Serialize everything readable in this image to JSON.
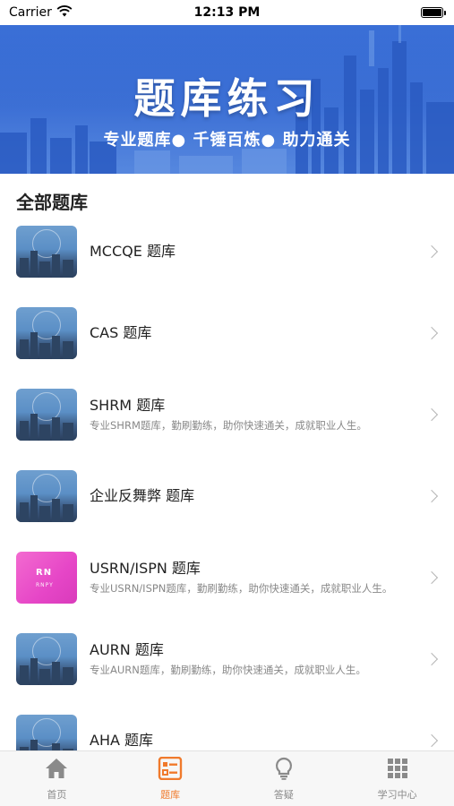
{
  "status_bar": {
    "carrier": "Carrier",
    "time": "12:13 PM"
  },
  "banner": {
    "title": "题库练习",
    "subtitle": "专业题库● 千锤百炼● 助力通关"
  },
  "section": {
    "title": "全部题库"
  },
  "banks": [
    {
      "title": "MCCQE 题库",
      "desc": "",
      "thumb": "city"
    },
    {
      "title": "CAS 题库",
      "desc": "",
      "thumb": "city"
    },
    {
      "title": "SHRM 题库",
      "desc": "专业SHRM题库，勤刷勤练，助你快速通关，成就职业人生。",
      "thumb": "city"
    },
    {
      "title": "企业反舞弊 题库",
      "desc": "",
      "thumb": "city"
    },
    {
      "title": "USRN/ISPN 题库",
      "desc": "专业USRN/ISPN题库，勤刷勤练，助你快速通关，成就职业人生。",
      "thumb": "pink",
      "thumb_text": "RN",
      "thumb_subtext": "RNPY"
    },
    {
      "title": "AURN 题库",
      "desc": "专业AURN题库，勤刷勤练，助你快速通关，成就职业人生。",
      "thumb": "city"
    },
    {
      "title": "AHA 题库",
      "desc": "",
      "thumb": "city"
    }
  ],
  "tabs": [
    {
      "label": "首页",
      "icon": "home-icon",
      "active": false
    },
    {
      "label": "题库",
      "icon": "question-bank-icon",
      "active": true
    },
    {
      "label": "答疑",
      "icon": "lightbulb-icon",
      "active": false
    },
    {
      "label": "学习中心",
      "icon": "grid-icon",
      "active": false
    }
  ],
  "colors": {
    "accent": "#f07a2c",
    "banner": "#2f63cf",
    "inactive": "#8a8a8a"
  }
}
